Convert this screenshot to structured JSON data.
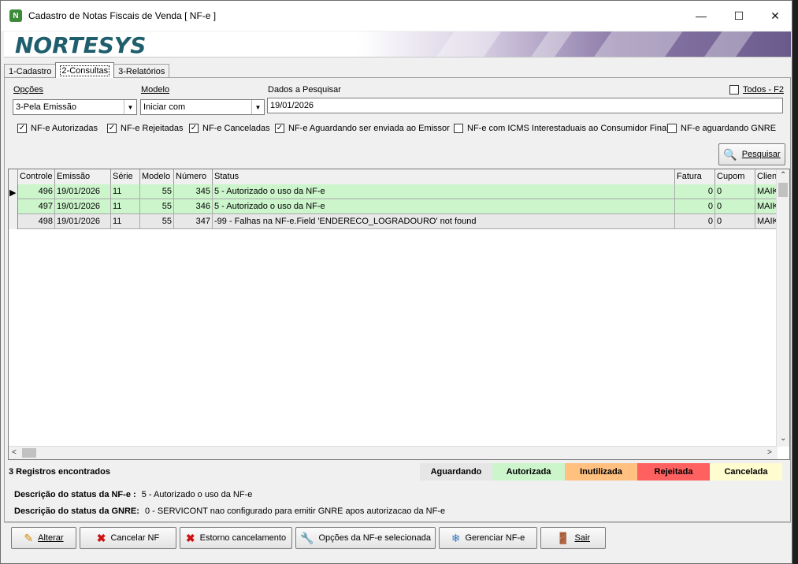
{
  "window": {
    "title": "Cadastro de Notas Fiscais de Venda [ NF-e ]"
  },
  "banner": {
    "logo": "NORTESYS"
  },
  "tabs": [
    {
      "label": "1-Cadastro"
    },
    {
      "label": "2-Consultas",
      "active": true
    },
    {
      "label": "3-Relatórios"
    }
  ],
  "filters": {
    "opcoes_label": "Opções",
    "opcoes_value": "3-Pela Emissão",
    "modelo_label": "Modelo",
    "modelo_value": "Iniciar com",
    "dados_label": "Dados a Pesquisar",
    "dados_value": "19/01/2026",
    "todos_label": "Todos - F2",
    "todos_checked": false
  },
  "checks": [
    {
      "label": "NF-e Autorizadas",
      "checked": true
    },
    {
      "label": "NF-e Rejeitadas",
      "checked": true
    },
    {
      "label": "NF-e Canceladas",
      "checked": true
    },
    {
      "label": "NF-e Aguardando ser enviada ao Emissor",
      "checked": true
    },
    {
      "label": "NF-e com ICMS Interestaduais ao Consumidor Final",
      "checked": false
    },
    {
      "label": "NF-e aguardando GNRE",
      "checked": false
    }
  ],
  "pesquisar_label": "Pesquisar",
  "grid": {
    "columns": [
      "Controle",
      "Emissão",
      "Série",
      "Modelo",
      "Número",
      "Status",
      "Fatura",
      "Cupom",
      "Client"
    ],
    "rows": [
      {
        "controle": "496",
        "emissao": "19/01/2026",
        "serie": "11",
        "modelo": "55",
        "numero": "345",
        "status": "5 - Autorizado o uso da NF-e",
        "fatura": "0",
        "cupom": "0",
        "cliente": "MAIK",
        "color": "#ccf5cc",
        "current": true
      },
      {
        "controle": "497",
        "emissao": "19/01/2026",
        "serie": "11",
        "modelo": "55",
        "numero": "346",
        "status": "5 - Autorizado o uso da NF-e",
        "fatura": "0",
        "cupom": "0",
        "cliente": "MAIK",
        "color": "#ccf5cc",
        "current": false
      },
      {
        "controle": "498",
        "emissao": "19/01/2026",
        "serie": "11",
        "modelo": "55",
        "numero": "347",
        "status": "-99 - Falhas na NF-e.Field 'ENDERECO_LOGRADOURO' not found",
        "fatura": "0",
        "cupom": "0",
        "cliente": "MAIK",
        "color": "#e8e8e8",
        "current": false
      }
    ]
  },
  "footer": {
    "count": "3 Registros encontrados",
    "legend": [
      {
        "label": "Aguardando",
        "color": "#e6e6e6"
      },
      {
        "label": "Autorizada",
        "color": "#ccf5cc"
      },
      {
        "label": "Inutilizada",
        "color": "#ffc080"
      },
      {
        "label": "Rejeitada",
        "color": "#ff6060"
      },
      {
        "label": "Cancelada",
        "color": "#fffcd0"
      }
    ],
    "desc_nfe_label": "Descrição do status da NF-e :",
    "desc_nfe_value": "5 - Autorizado o uso da NF-e",
    "desc_gnre_label": "Descrição do status da GNRE:",
    "desc_gnre_value": "0 - SERVICONT nao configurado para emitir GNRE apos autorizacao da NF-e"
  },
  "buttons": {
    "alterar": "Alterar",
    "cancelar": "Cancelar NF",
    "estorno": "Estorno cancelamento",
    "opcoes": "Opções da NF-e selecionada",
    "gerenciar": "Gerenciar NF-e",
    "sair": "Sair"
  },
  "icons": {
    "app": "nfe-app-icon",
    "pencil": "pencil-icon",
    "cancel": "red-x-icon",
    "wrench": "wrench-icon",
    "manage": "swirl-icon",
    "exit": "door-exit-icon",
    "search": "magnifier-icon"
  }
}
